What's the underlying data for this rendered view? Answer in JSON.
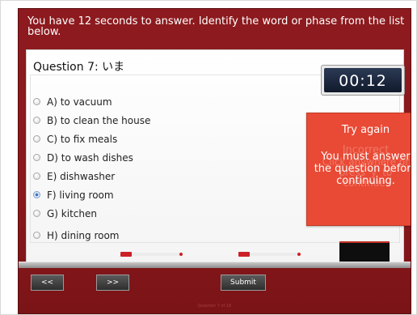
{
  "instructions": "You have 12 seconds to answer. Identify the word or phase from the list below.",
  "question": {
    "label": "Question 7:",
    "prompt": "いま"
  },
  "timer": "00:12",
  "options": [
    {
      "label": "A) to vacuum",
      "selected": false
    },
    {
      "label": "B) to clean the house",
      "selected": false
    },
    {
      "label": "C) to fix meals",
      "selected": false
    },
    {
      "label": "D) to wash dishes",
      "selected": false
    },
    {
      "label": "E) dishwasher",
      "selected": false
    },
    {
      "label": "F) living room",
      "selected": true
    },
    {
      "label": "G) kitchen",
      "selected": false
    },
    {
      "label": "H) dining room",
      "selected": false
    }
  ],
  "feedback": {
    "title": "Try again",
    "message_line1": "You must answer",
    "message_line2": "the question before",
    "message_line3": "continuing.",
    "ghost_title": "Incorrect",
    "ghost_line1": "Click anywhere or",
    "ghost_line2": "press 'y' to",
    "ghost_line3": "continue."
  },
  "buttons": {
    "prev": "<<",
    "next": ">>",
    "submit": "Submit"
  },
  "footer": "Question 7 of 16",
  "colors": {
    "background": "#8c1a1e",
    "feedback": "#e94a35",
    "timer": "#1a2438"
  }
}
